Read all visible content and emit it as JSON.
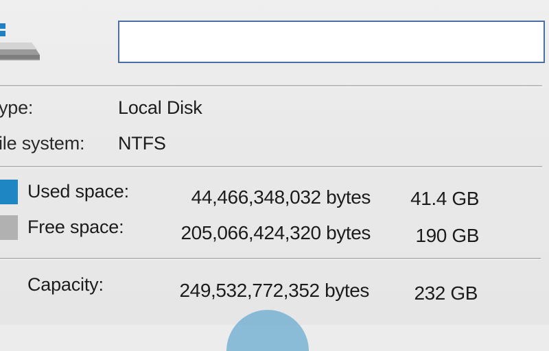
{
  "header": {
    "drive_label_value": ""
  },
  "general": {
    "type_label": "ype:",
    "type_value": "Local Disk",
    "filesystem_label": "ile system:",
    "filesystem_value": "NTFS"
  },
  "space": {
    "used": {
      "label": "Used space:",
      "bytes": "44,466,348,032 bytes",
      "size": "41.4 GB",
      "color": "#1e86c3"
    },
    "free": {
      "label": "Free space:",
      "bytes": "205,066,424,320 bytes",
      "size": "190 GB",
      "color": "#b1b1b1"
    },
    "capacity": {
      "label": "Capacity:",
      "bytes": "249,532,772,352 bytes",
      "size": "232 GB"
    }
  },
  "colors": {
    "accent_border": "#4a6fa3",
    "used": "#1e86c3",
    "free": "#b1b1b1"
  },
  "icons": [
    "drive-icon"
  ]
}
